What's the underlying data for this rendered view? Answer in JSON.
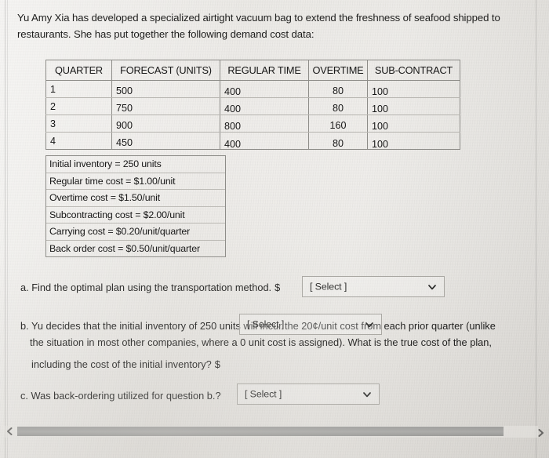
{
  "intro": {
    "paragraph": "Yu Amy Xia has developed a specialized airtight vacuum bag to extend the freshness of seafood shipped to restaurants. She has put together the following demand cost data:"
  },
  "demand_table": {
    "headers": [
      "QUARTER",
      "FORECAST (UNITS)",
      "REGULAR TIME",
      "OVERTIME",
      "SUB-CONTRACT"
    ],
    "rows": [
      {
        "quarter": "1",
        "forecast": "500",
        "regular_time": "400",
        "overtime": "80",
        "sub_contract": "100"
      },
      {
        "quarter": "2",
        "forecast": "750",
        "regular_time": "400",
        "overtime": "80",
        "sub_contract": "100"
      },
      {
        "quarter": "3",
        "forecast": "900",
        "regular_time": "800",
        "overtime": "160",
        "sub_contract": "100"
      },
      {
        "quarter": "4",
        "forecast": "450",
        "regular_time": "400",
        "overtime": "80",
        "sub_contract": "100"
      }
    ]
  },
  "cost_box": {
    "lines": [
      "Initial inventory = 250 units",
      "Regular time cost = $1.00/unit",
      "Overtime cost = $1.50/unit",
      "Subcontracting cost = $2.00/unit",
      "Carrying cost = $0.20/unit/quarter",
      "Back order cost = $0.50/unit/quarter"
    ]
  },
  "questions": {
    "a": {
      "text": "a. Find the optimal plan using the transportation method.",
      "currency_symbol": "$",
      "select_value": "[ Select ]"
    },
    "b": {
      "line1": "b. Yu decides that the initial inventory of 250 units will incur the 20¢/unit cost from each prior quarter (unlike",
      "line2": "the situation in most other companies, where a 0 unit cost is assigned). What is the true cost of the plan,",
      "line3": "including the cost of the initial inventory?",
      "currency_symbol": "$",
      "select_value": "[ Select ]"
    },
    "c": {
      "text": "c. Was back-ordering utilized for question b.?",
      "select_value": "[ Select ]"
    }
  },
  "scrollbar": {
    "left_arrow": "scroll-left-arrow",
    "right_arrow": "scroll-right-arrow",
    "orientation": "horizontal"
  },
  "colors": {
    "page_background": "#e9e7e4",
    "text": "#1e1e1d",
    "table_border": "#8d8c88",
    "row_rule": "#b9b7b2",
    "select_border": "#a9a7a2",
    "scroll_thumb": "#919190"
  }
}
